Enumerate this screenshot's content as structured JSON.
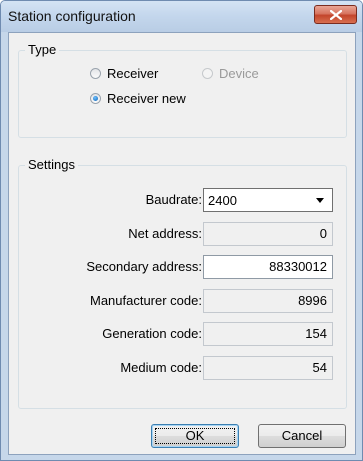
{
  "window": {
    "title": "Station configuration"
  },
  "type_group": {
    "label": "Type",
    "options": [
      {
        "label": "Receiver",
        "selected": false,
        "enabled": true
      },
      {
        "label": "Device",
        "selected": false,
        "enabled": false
      },
      {
        "label": "Receiver new",
        "selected": true,
        "enabled": true
      }
    ]
  },
  "settings_group": {
    "label": "Settings",
    "baudrate": {
      "label": "Baudrate:",
      "value": "2400"
    },
    "net_address": {
      "label": "Net address:",
      "value": "0"
    },
    "secondary_address": {
      "label": "Secondary address:",
      "value": "88330012"
    },
    "manufacturer_code": {
      "label": "Manufacturer code:",
      "value": "8996"
    },
    "generation_code": {
      "label": "Generation code:",
      "value": "154"
    },
    "medium_code": {
      "label": "Medium code:",
      "value": "54"
    }
  },
  "buttons": {
    "ok": "OK",
    "cancel": "Cancel"
  },
  "colors": {
    "close_button": "#c3452b",
    "titlebar": "#c3d6ec",
    "dialog_bg": "#f0f0f0"
  }
}
